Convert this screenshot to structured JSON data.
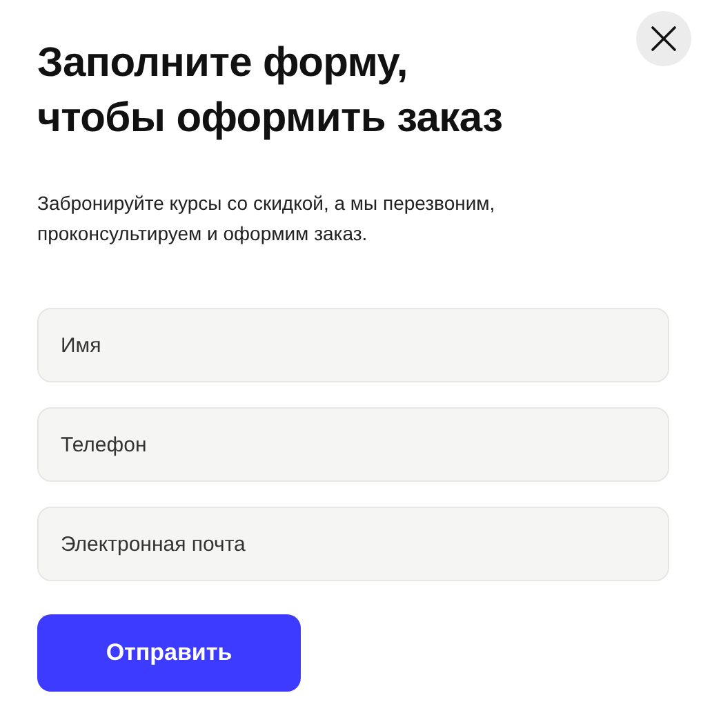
{
  "title": [
    "Заполните форму,",
    "чтобы оформить заказ"
  ],
  "description": "Забронируйте курсы со скидкой, а мы перезвоним, проконсультируем и оформим заказ.",
  "fields": [
    {
      "placeholder": "Имя"
    },
    {
      "placeholder": "Телефон"
    },
    {
      "placeholder": "Электронная почта"
    }
  ],
  "submit_button": {
    "label": "Отправить"
  }
}
